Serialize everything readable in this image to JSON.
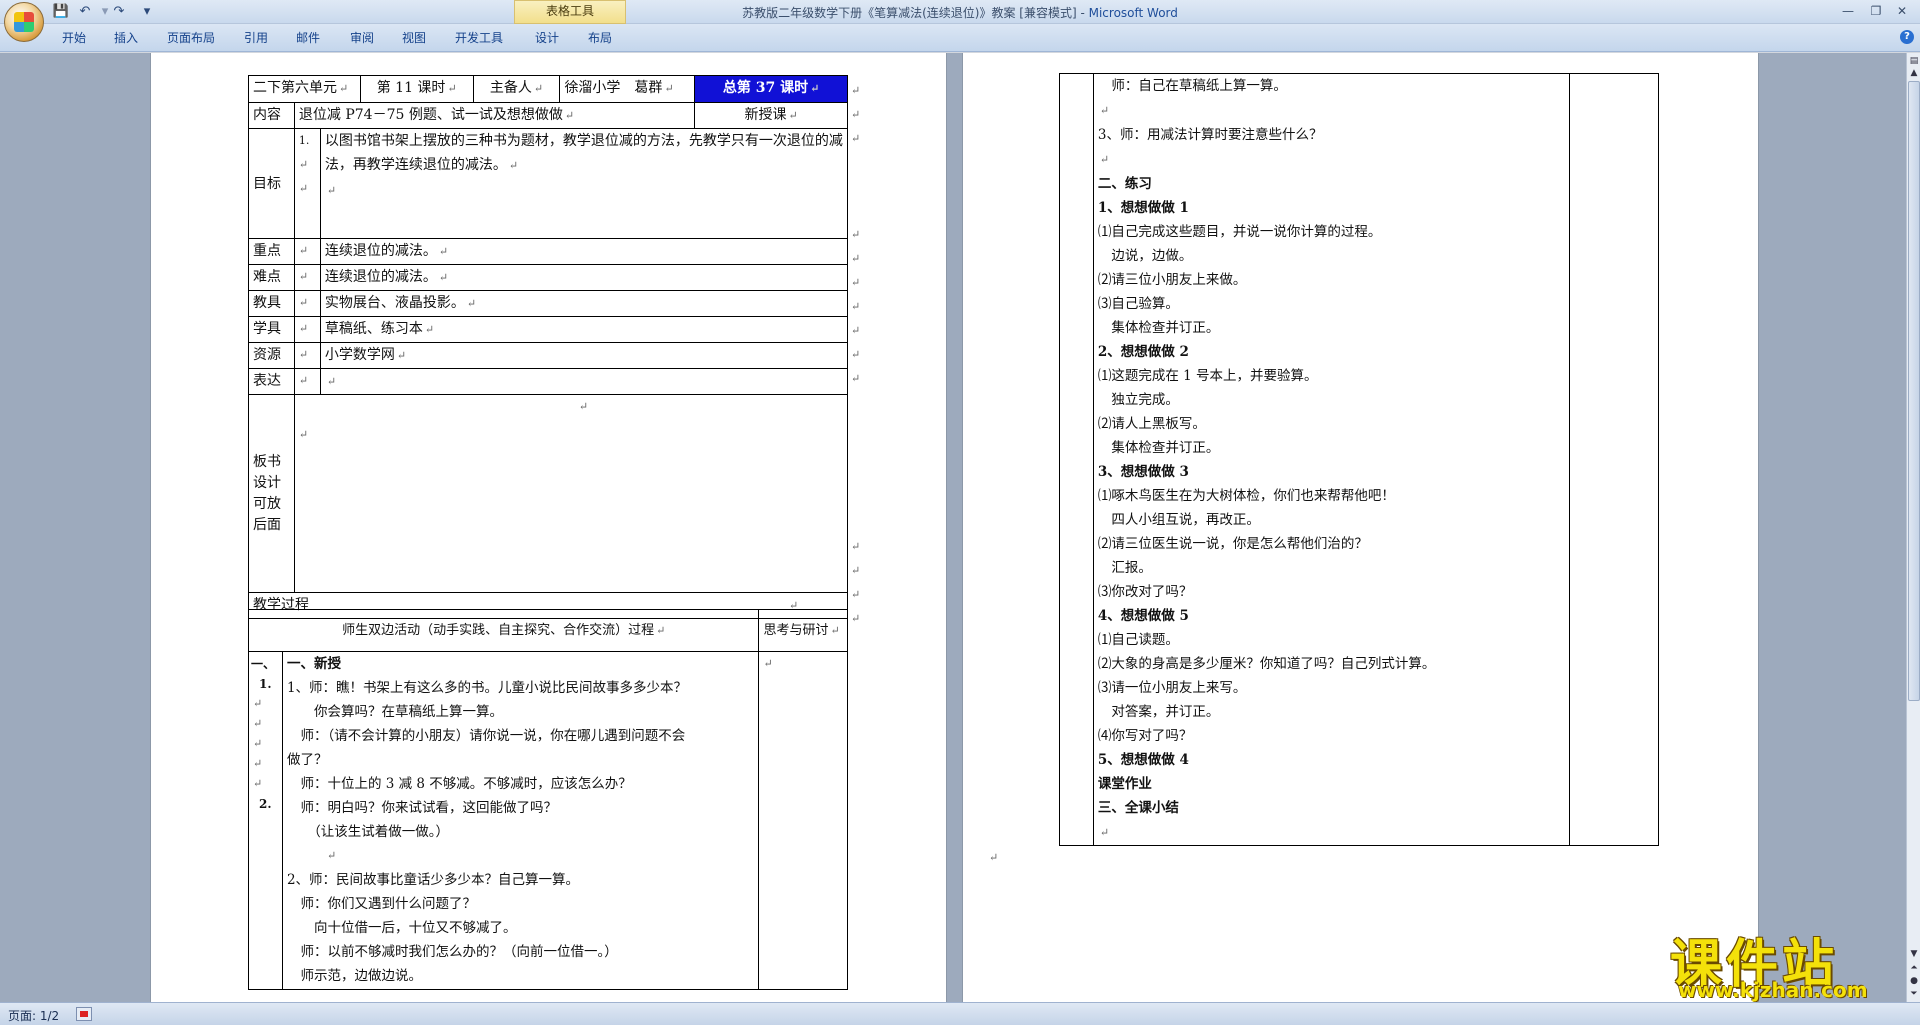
{
  "window": {
    "title_doc": "苏教版二年级数学下册《笔算减法(连续退位)》教案 [兼容模式]",
    "title_sep": " - ",
    "title_app": "Microsoft Word",
    "contextual_tab_group": "表格工具"
  },
  "qat": {
    "customize": "▾"
  },
  "ribbon_tabs": [
    "开始",
    "插入",
    "页面布局",
    "引用",
    "邮件",
    "审阅",
    "视图",
    "开发工具",
    "设计",
    "布局"
  ],
  "status": {
    "page": "页面: 1/2"
  },
  "watermark": {
    "main": "课件站",
    "url": "www.kjzhan.com"
  },
  "page1": {
    "header": {
      "unit": "二下第六单元",
      "lesson": "第 11 课时",
      "preparer_label": "主备人",
      "preparer": "徐溜小学　葛群",
      "total": "总第 37 课时"
    },
    "rows": [
      {
        "label": "内容",
        "value": "退位减 P74－75 例题、试一试及想想做做",
        "extra": "新授课"
      },
      {
        "label": "目标",
        "num": "1.",
        "value": "以图书馆书架上摆放的三种书为题材，教学退位减的方法，先教学只有一次退位的减法，再教学连续退位的减法。"
      },
      {
        "label": "重点",
        "value": "连续退位的减法。"
      },
      {
        "label": "难点",
        "value": "连续退位的减法。"
      },
      {
        "label": "教具",
        "value": "实物展台、液晶投影。"
      },
      {
        "label": "学具",
        "value": "草稿纸、练习本"
      },
      {
        "label": "资源",
        "value": "小学数学网"
      },
      {
        "label": "表达",
        "value": ""
      },
      {
        "label": "板书设计可放后面",
        "value": ""
      }
    ],
    "process_title": "教学过程",
    "activity_header": "师生双边活动（动手实践、自主探究、合作交流）过程",
    "reflection_header": "思考与研讨",
    "left_col": [
      "一、",
      "1.",
      "2."
    ],
    "body": [
      "一、新授",
      "1、师：瞧！书架上有这么多的书。儿童小说比民间故事多多少本？",
      "　　你会算吗？在草稿纸上算一算。",
      "　师：（请不会计算的小朋友）请你说一说，你在哪儿遇到问题不会",
      "做了？",
      "　师：十位上的 3 减 8 不够减。不够减时，应该怎么办？",
      "　师：明白吗？你来试试看，这回能做了吗？",
      "　　（让该生试着做一做。）",
      "",
      "2、师：民间故事比童话少多少本？自己算一算。",
      "　师：你们又遇到什么问题了？",
      "　　向十位借一后，十位又不够减了。",
      "　师：以前不够减时我们怎么办的？（向前一位借一。）",
      "　师示范，边做边说。"
    ]
  },
  "page2": {
    "lines": [
      {
        "t": "　师：自己在草稿纸上算一算。",
        "b": false
      },
      {
        "t": "",
        "b": false
      },
      {
        "t": "3、师：用减法计算时要注意些什么？",
        "b": false
      },
      {
        "t": "",
        "b": false
      },
      {
        "t": "二、练习",
        "b": true
      },
      {
        "t": "1、想想做做 1",
        "b": true
      },
      {
        "t": "⑴自己完成这些题目，并说一说你计算的过程。",
        "b": false
      },
      {
        "t": "　边说，边做。",
        "b": false
      },
      {
        "t": "⑵请三位小朋友上来做。",
        "b": false
      },
      {
        "t": "⑶自己验算。",
        "b": false
      },
      {
        "t": "　集体检查并订正。",
        "b": false
      },
      {
        "t": "2、想想做做 2",
        "b": true
      },
      {
        "t": "⑴这题完成在 1 号本上，并要验算。",
        "b": false
      },
      {
        "t": "　独立完成。",
        "b": false
      },
      {
        "t": "⑵请人上黑板写。",
        "b": false
      },
      {
        "t": "　集体检查并订正。",
        "b": false
      },
      {
        "t": "3、想想做做 3",
        "b": true
      },
      {
        "t": "⑴啄木鸟医生在为大树体检，你们也来帮帮他吧！",
        "b": false
      },
      {
        "t": "　四人小组互说，再改正。",
        "b": false
      },
      {
        "t": "⑵请三位医生说一说，你是怎么帮他们治的？",
        "b": false
      },
      {
        "t": "　汇报。",
        "b": false
      },
      {
        "t": "⑶你改对了吗？",
        "b": false
      },
      {
        "t": "4、想想做做 5",
        "b": true
      },
      {
        "t": "⑴自己读题。",
        "b": false
      },
      {
        "t": "⑵大象的身高是多少厘米？你知道了吗？自己列式计算。",
        "b": false
      },
      {
        "t": "⑶请一位小朋友上来写。",
        "b": false
      },
      {
        "t": "　对答案，并订正。",
        "b": false
      },
      {
        "t": "⑷你写对了吗？",
        "b": false
      },
      {
        "t": "5、想想做做 4",
        "b": true
      },
      {
        "t": "课堂作业",
        "b": true
      },
      {
        "t": "三、全课小结",
        "b": true
      },
      {
        "t": "",
        "b": false
      }
    ]
  }
}
